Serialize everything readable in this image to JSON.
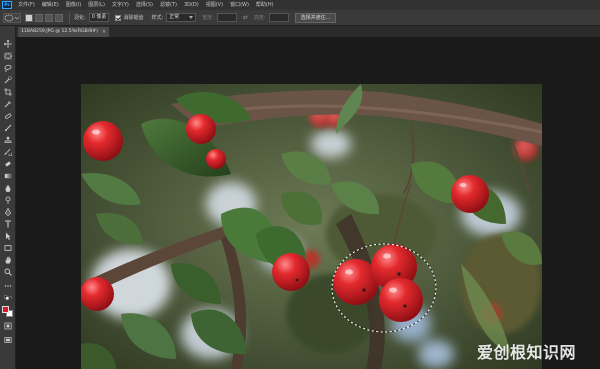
{
  "app": {
    "logo_text": "Ps"
  },
  "menu": {
    "items": [
      "文件(F)",
      "编辑(E)",
      "图像(I)",
      "图层(L)",
      "文字(Y)",
      "选择(S)",
      "滤镜(T)",
      "3D(D)",
      "视图(V)",
      "窗口(W)",
      "帮助(H)"
    ]
  },
  "options": {
    "feather_label": "羽化:",
    "feather_value": "0 像素",
    "antialias_label": "消除锯齿",
    "style_label": "样式:",
    "style_value": "正常",
    "width_label": "宽度:",
    "height_label": "高度:",
    "select_subject_button": "选择并遮住..."
  },
  "document": {
    "tab_label": "11BA8259.JPG @ 12.5%(RGB/8#)",
    "close_glyph": "×"
  },
  "colors": {
    "foreground": "#d81b28",
    "background": "#ffffff",
    "accent": "#31a8ff"
  },
  "tools": [
    "move-icon",
    "elliptical-marquee-icon",
    "lasso-icon",
    "quick-select-icon",
    "crop-icon",
    "eyedropper-icon",
    "spot-healing-icon",
    "brush-icon",
    "clone-stamp-icon",
    "history-brush-icon",
    "eraser-icon",
    "gradient-icon",
    "blur-icon",
    "dodge-icon",
    "pen-icon",
    "type-icon",
    "path-selection-icon",
    "rectangle-icon",
    "hand-icon",
    "zoom-icon",
    "more-tools-icon"
  ],
  "watermark": "爱创根知识网"
}
